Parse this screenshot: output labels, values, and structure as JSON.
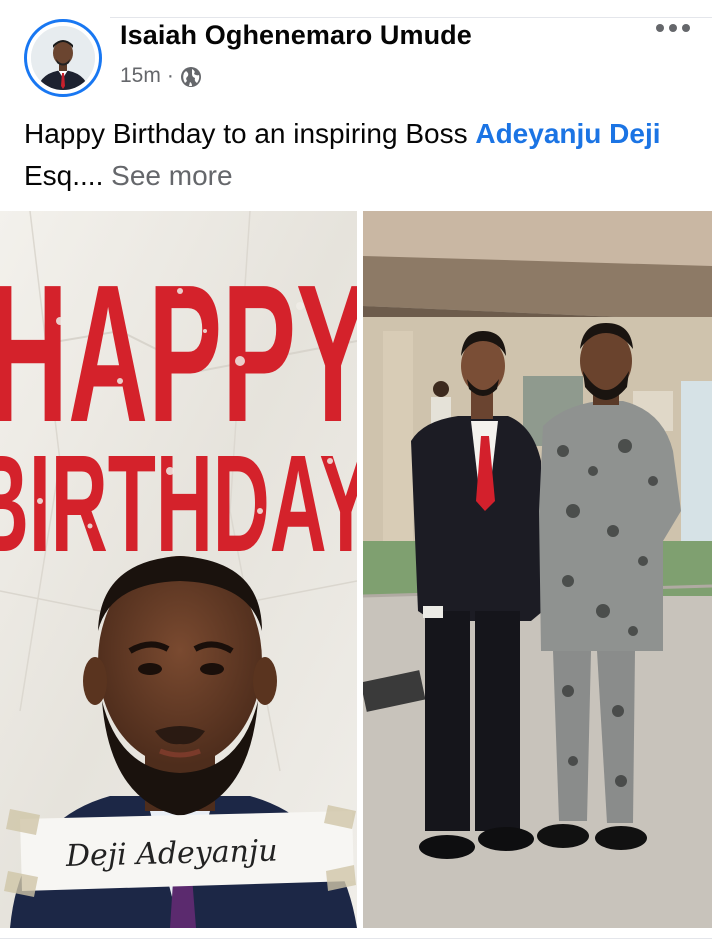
{
  "post": {
    "author": "Isaiah Oghenemaro Umude",
    "time": "15m",
    "separator": "·",
    "privacy_icon": "globe-icon",
    "more_icon": "more-options-icon",
    "caption": {
      "part1": "Happy Birthday to an inspiring Boss ",
      "tag": "Adeyanju Deji",
      "part2": " Esq.... ",
      "see_more": "See more"
    }
  },
  "media": {
    "image1": {
      "line1": "HAPPY",
      "line2": "BIRTHDAY",
      "signature": "Deji Adeyanju"
    }
  },
  "colors": {
    "link_blue": "#1b74e4",
    "avatar_ring": "#1877f2",
    "secondary_text": "#65676b",
    "poster_red": "#d4222b"
  }
}
